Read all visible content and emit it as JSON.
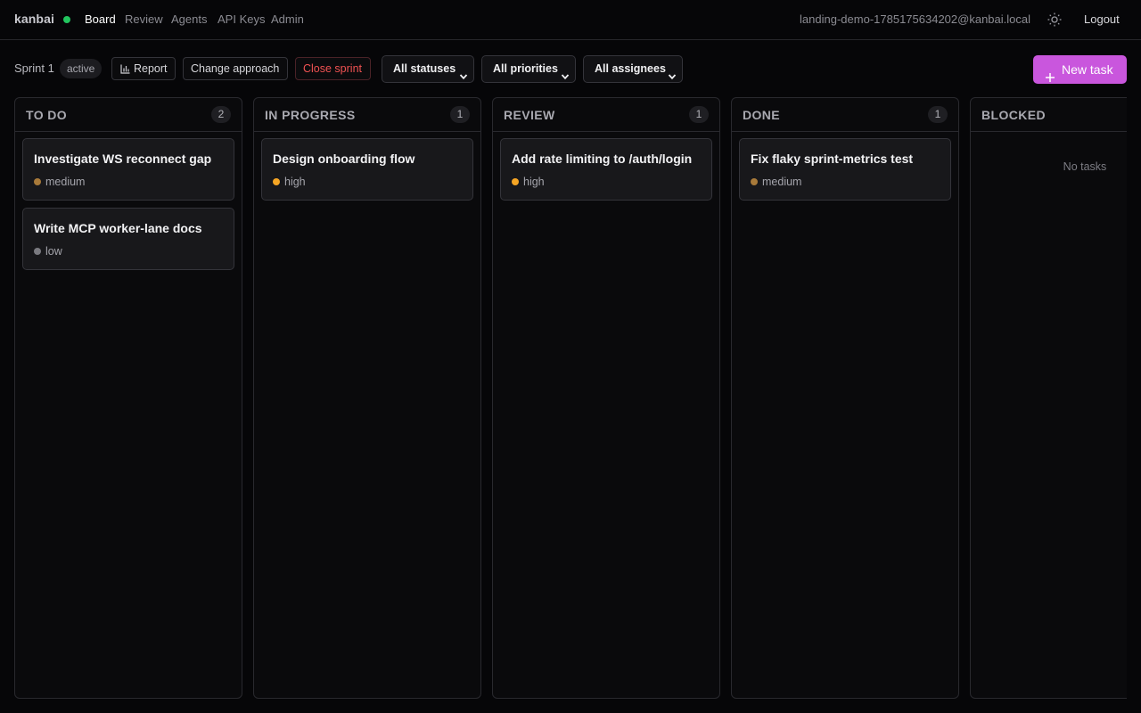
{
  "app": {
    "name": "kanbai",
    "status_color": "#22c55e"
  },
  "nav": {
    "items": [
      {
        "label": "Board",
        "active": true
      },
      {
        "label": "Review",
        "active": false
      },
      {
        "label": "Agents",
        "active": false
      },
      {
        "label": "API Keys",
        "active": false
      },
      {
        "label": "Admin",
        "active": false
      }
    ]
  },
  "user": {
    "email": "landing-demo-1785175634202@kanbai.local",
    "logout_label": "Logout",
    "theme_icon": "sun-icon"
  },
  "toolbar": {
    "sprint_name": "Sprint 1",
    "sprint_status": "active",
    "report_label": "Report",
    "change_approach_label": "Change approach",
    "close_sprint_label": "Close sprint",
    "filters": {
      "status": "All statuses",
      "priority": "All priorities",
      "assignee": "All assignees"
    },
    "new_task_label": "New task",
    "accent_color": "#c956dd",
    "danger_color": "#f05252"
  },
  "priority_colors": {
    "high": "#f5a524",
    "medium": "#a87a3a",
    "low": "#7a7a80"
  },
  "columns": [
    {
      "title": "TO DO",
      "count": "2",
      "tasks": [
        {
          "title": "Investigate WS reconnect gap",
          "priority": "medium"
        },
        {
          "title": "Write MCP worker-lane docs",
          "priority": "low"
        }
      ]
    },
    {
      "title": "IN PROGRESS",
      "count": "1",
      "tasks": [
        {
          "title": "Design onboarding flow",
          "priority": "high"
        }
      ]
    },
    {
      "title": "REVIEW",
      "count": "1",
      "tasks": [
        {
          "title": "Add rate limiting to /auth/login",
          "priority": "high"
        }
      ]
    },
    {
      "title": "DONE",
      "count": "1",
      "tasks": [
        {
          "title": "Fix flaky sprint-metrics test",
          "priority": "medium"
        }
      ]
    },
    {
      "title": "BLOCKED",
      "count": "",
      "tasks": [],
      "empty_label": "No tasks"
    }
  ]
}
